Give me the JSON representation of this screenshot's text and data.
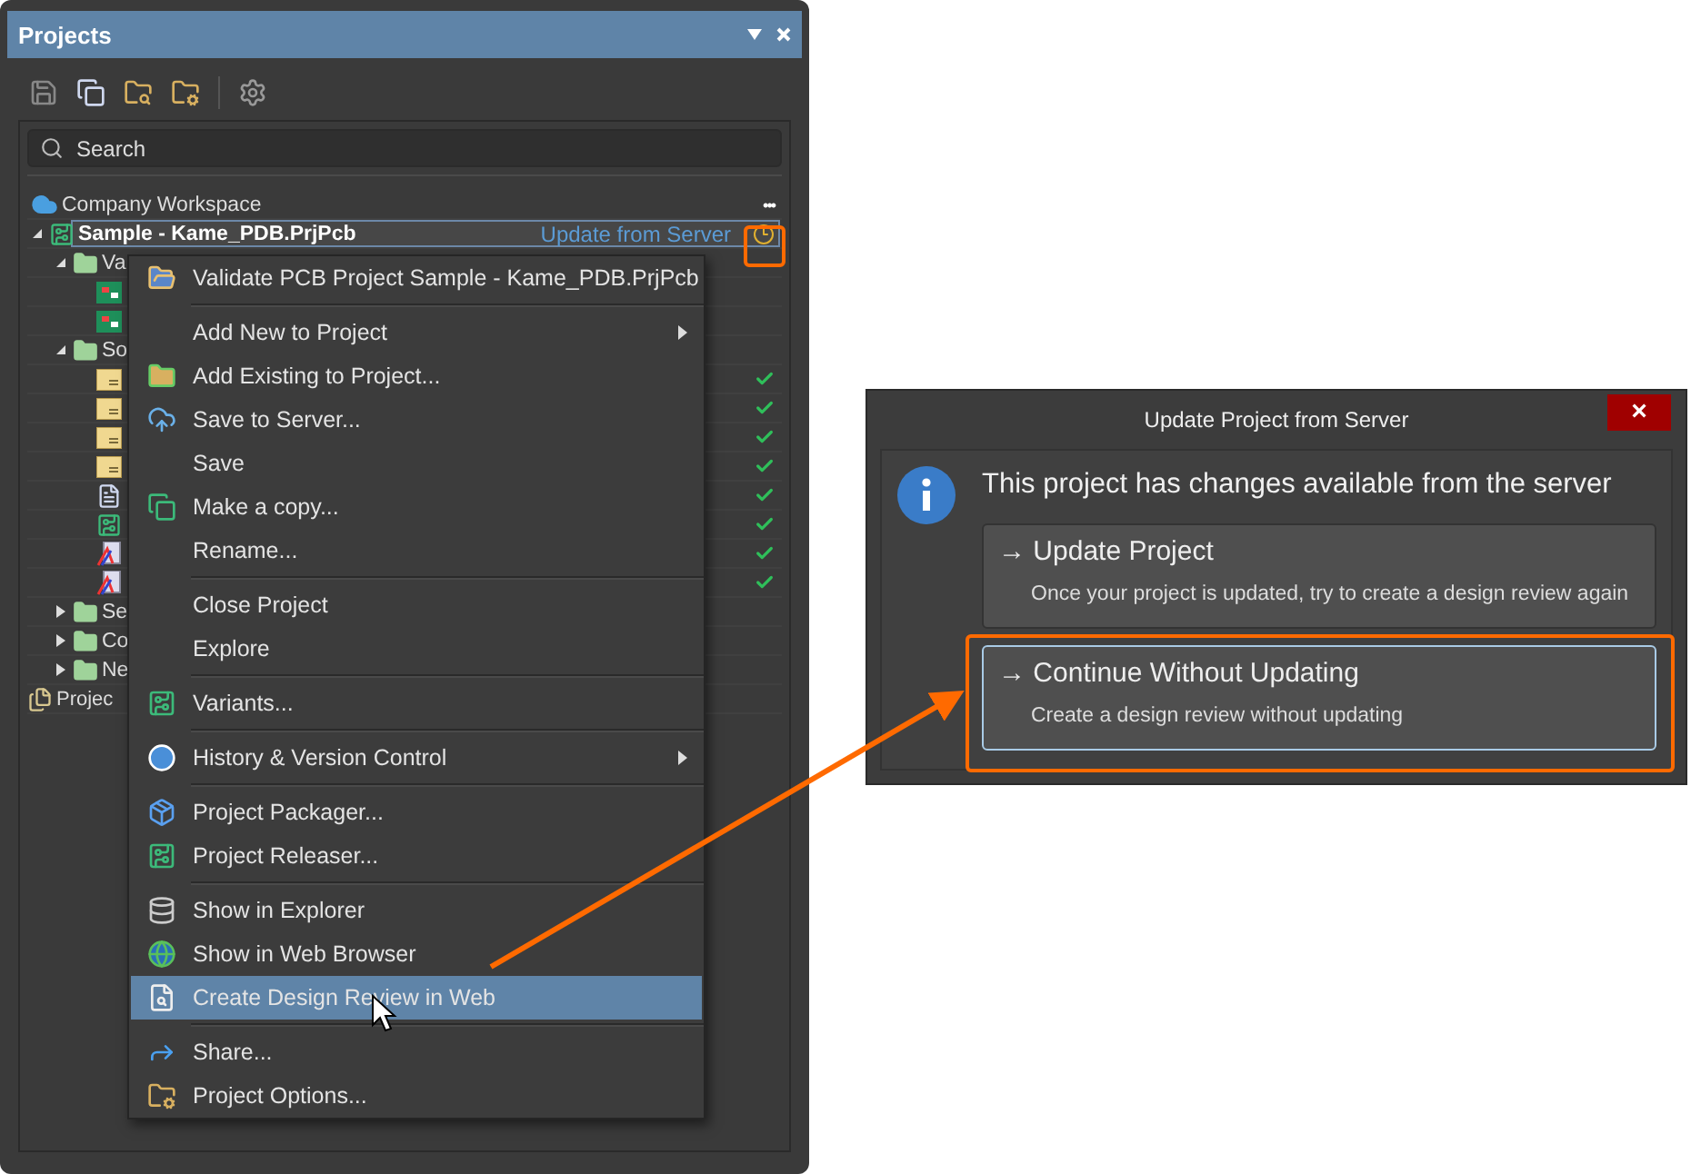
{
  "panel": {
    "title": "Projects",
    "search": {
      "placeholder": "Search"
    }
  },
  "tree": {
    "workspace": {
      "label": "Company Workspace",
      "more": "•••"
    },
    "items": [
      {
        "kind": "project",
        "label": "Sample - Kame_PDB.PrjPcb",
        "selected": true,
        "expanded": true,
        "action": "Update from Server",
        "children": [
          {
            "kind": "folder",
            "label": "Va",
            "expanded": true,
            "children": [
              {
                "kind": "pcb"
              },
              {
                "kind": "pcb"
              }
            ]
          },
          {
            "kind": "folder",
            "label": "So",
            "expanded": true,
            "children": [
              {
                "kind": "sheet",
                "synced": true
              },
              {
                "kind": "sheet",
                "synced": true
              },
              {
                "kind": "sheet",
                "synced": true
              },
              {
                "kind": "sheet",
                "synced": true
              },
              {
                "kind": "sheet-doc",
                "synced": true
              },
              {
                "kind": "board",
                "synced": true
              },
              {
                "kind": "output",
                "synced": true
              },
              {
                "kind": "output",
                "synced": true
              }
            ]
          },
          {
            "kind": "folder",
            "label": "Se",
            "expanded": false
          },
          {
            "kind": "folder",
            "label": "Co",
            "expanded": false
          },
          {
            "kind": "folder",
            "label": "Ne",
            "expanded": false
          }
        ]
      },
      {
        "kind": "group",
        "label": "Projec",
        "selected": false
      }
    ]
  },
  "menu": [
    {
      "kind": "item",
      "label": "Validate PCB Project Sample - Kame_PDB.PrjPcb",
      "selected": false
    },
    {
      "kind": "separator"
    },
    {
      "kind": "item",
      "label": "Add New to Project",
      "selected": false,
      "submenu": true
    },
    {
      "kind": "item",
      "label": "Add Existing to Project...",
      "selected": false,
      "submenu": false
    },
    {
      "kind": "item",
      "label": "Save to Server...",
      "selected": false,
      "submenu": false
    },
    {
      "kind": "item",
      "label": "Save",
      "selected": false,
      "submenu": false
    },
    {
      "kind": "item",
      "label": "Make a copy...",
      "selected": false,
      "submenu": false
    },
    {
      "kind": "item",
      "label": "Rename...",
      "selected": false,
      "submenu": false
    },
    {
      "kind": "separator"
    },
    {
      "kind": "item",
      "label": "Close Project",
      "selected": false,
      "submenu": false
    },
    {
      "kind": "item",
      "label": "Explore",
      "selected": false,
      "submenu": false
    },
    {
      "kind": "separator"
    },
    {
      "kind": "item",
      "label": "Variants...",
      "selected": false,
      "submenu": false
    },
    {
      "kind": "separator"
    },
    {
      "kind": "item",
      "label": "History & Version Control",
      "selected": false,
      "submenu": true
    },
    {
      "kind": "separator"
    },
    {
      "kind": "item",
      "label": "Project Packager...",
      "selected": false,
      "submenu": false
    },
    {
      "kind": "item",
      "label": "Project Releaser...",
      "selected": false,
      "submenu": false
    },
    {
      "kind": "separator"
    },
    {
      "kind": "item",
      "label": "Show in Explorer",
      "selected": false,
      "submenu": false
    },
    {
      "kind": "item",
      "label": "Show in Web Browser",
      "selected": false,
      "submenu": false
    },
    {
      "kind": "item",
      "label": "Create Design Review in Web",
      "selected": true,
      "submenu": false
    },
    {
      "kind": "separator"
    },
    {
      "kind": "item",
      "label": "Share...",
      "selected": false,
      "submenu": false
    },
    {
      "kind": "item",
      "label": "Project Options...",
      "selected": false,
      "submenu": false
    }
  ],
  "dialog": {
    "title": "Update Project from Server",
    "close": "×",
    "message": "This project has changes available from the server",
    "options": [
      {
        "arrow": "→",
        "title": "Update Project",
        "description": "Once your project is updated, try to create a design review again",
        "selected": false
      },
      {
        "arrow": "→",
        "title": "Continue Without Updating",
        "description": "Create a design review without updating",
        "selected": true
      }
    ]
  }
}
